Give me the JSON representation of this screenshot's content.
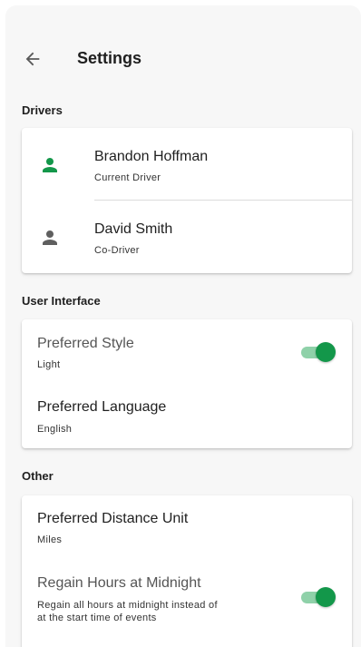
{
  "header": {
    "title": "Settings",
    "back_icon": "arrow-left-icon"
  },
  "colors": {
    "accent": "#13974a",
    "accent_track": "#8fd1a9",
    "inactive_icon": "#5f5f5f"
  },
  "sections": {
    "drivers": {
      "label": "Drivers",
      "items": [
        {
          "name": "Brandon Hoffman",
          "role": "Current Driver",
          "icon": "person-icon",
          "active": true
        },
        {
          "name": "David Smith",
          "role": "Co-Driver",
          "icon": "person-icon",
          "active": false
        }
      ]
    },
    "ui": {
      "label": "User Interface",
      "style": {
        "title": "Preferred Style",
        "value": "Light",
        "toggle_on": true
      },
      "language": {
        "title": "Preferred Language",
        "value": "English"
      }
    },
    "other": {
      "label": "Other",
      "distance": {
        "title": "Preferred Distance Unit",
        "value": "Miles"
      },
      "regain": {
        "title": "Regain Hours at Midnight",
        "description_line1": "Regain all hours at midnight instead of",
        "description_line2": "at the start time of events",
        "toggle_on": true
      }
    }
  }
}
